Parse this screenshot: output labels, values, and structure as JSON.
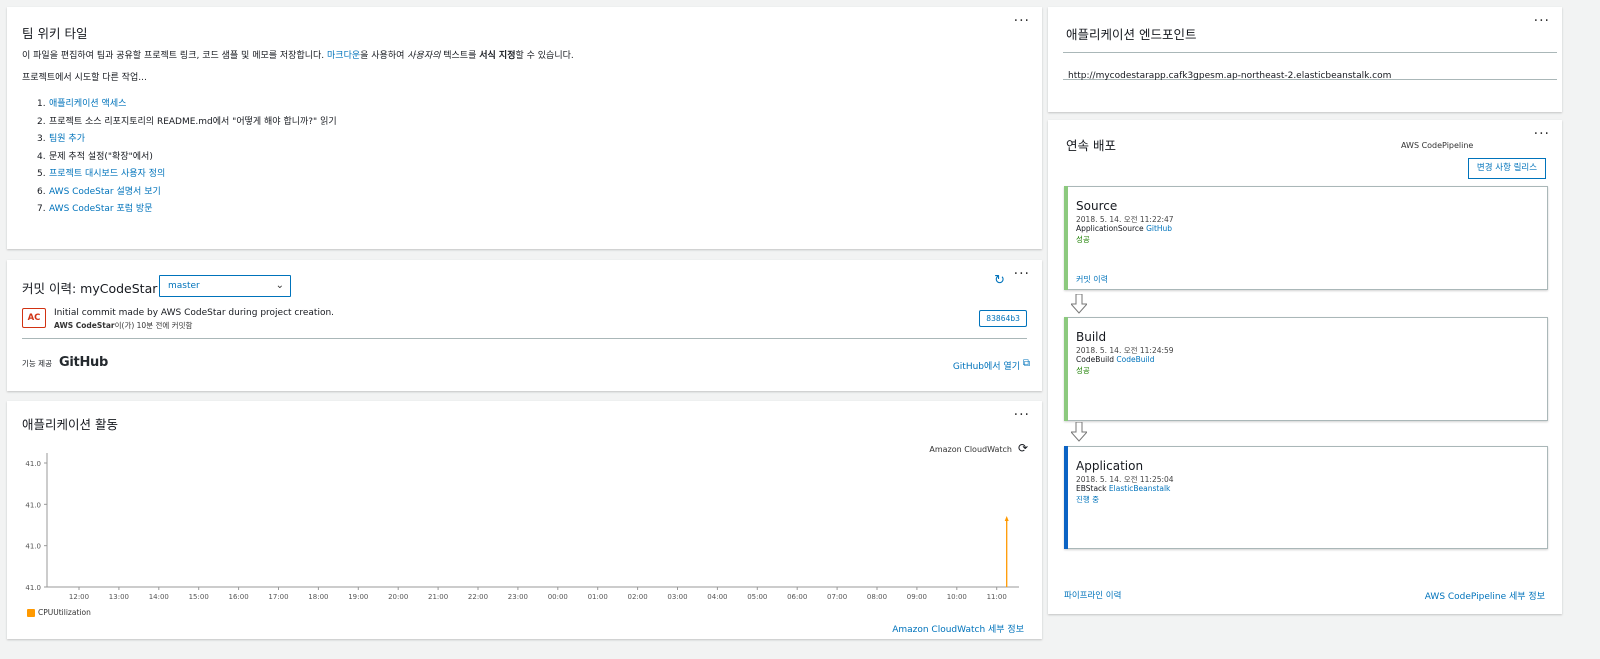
{
  "wiki": {
    "title": "팀 위키 타일",
    "desc_pre": "이 파일을 편집하여 팀과 공유할 프로젝트 링크, 코드 샘플 및 메모를 저장합니다. ",
    "desc_link": "마크다운",
    "desc_mid": "을 사용하여 ",
    "desc_italic": "사용자의",
    "desc_mid2": " 텍스트를 ",
    "desc_bold": "서식 지정",
    "desc_post": "할 수 있습니다.",
    "subtitle": "프로젝트에서 시도할 다른 작업...",
    "items": [
      {
        "num": "1.",
        "text": "애플리케이션 액세스",
        "link": true
      },
      {
        "num": "2.",
        "text": "프로젝트 소스 리포지토리의 README.md에서 \"어떻게 해야 합니까?\" 읽기",
        "link": false
      },
      {
        "num": "3.",
        "text": "팀원 추가",
        "link": true
      },
      {
        "num": "4.",
        "text": "문제 추적 설정(\"확장\"에서)",
        "link": false
      },
      {
        "num": "5.",
        "text": "프로젝트 대시보드 사용자 정의",
        "link": true
      },
      {
        "num": "6.",
        "text": "AWS CodeStar 설명서 보기",
        "link": true
      },
      {
        "num": "7.",
        "text": "AWS CodeStar 포럼 방문",
        "link": true
      }
    ]
  },
  "commits": {
    "title": "커밋 이력: myCodeStar",
    "branch": "master",
    "avatar": "AC",
    "message": "Initial commit made by AWS CodeStar during project creation.",
    "author": "AWS CodeStar",
    "meta": "이(가) 10분 전에 커밋함",
    "hash": "83864b3",
    "powered_by": "기능 제공",
    "provider": "GitHub",
    "open_link": "GitHub에서 열기"
  },
  "activity": {
    "title": "애플리케이션 활동",
    "source": "Amazon CloudWatch",
    "detail_link": "Amazon CloudWatch 세부 정보"
  },
  "chart_data": {
    "type": "line",
    "title": "",
    "xlabel": "",
    "ylabel": "",
    "y_ticks": [
      "41.0",
      "41.0",
      "41.0",
      "41.0"
    ],
    "x": [
      "12:00",
      "13:00",
      "14:00",
      "15:00",
      "16:00",
      "17:00",
      "18:00",
      "19:00",
      "20:00",
      "21:00",
      "22:00",
      "23:00",
      "00:00",
      "01:00",
      "02:00",
      "03:00",
      "04:00",
      "05:00",
      "06:00",
      "07:00",
      "08:00",
      "09:00",
      "10:00",
      "11:00"
    ],
    "series": [
      {
        "name": "CPUUtilization",
        "color": "#ff9900",
        "points": [
          {
            "x": "11:00",
            "y": 41.0
          }
        ]
      }
    ],
    "grid": false,
    "legend": "bottom-left"
  },
  "endpoint": {
    "title": "애플리케이션 엔드포인트",
    "url": "http://mycodestarapp.cafk3gpesm.ap-northeast-2.elasticbeanstalk.com"
  },
  "pipeline": {
    "title": "연속 배포",
    "provider": "AWS CodePipeline",
    "release_button": "변경 사항 릴리스",
    "stages": [
      {
        "name": "Source",
        "time": "2018. 5. 14. 오전 11:22:47",
        "action": "ApplicationSource",
        "action_link": "GitHub",
        "status": "성공",
        "status_color": "#1d8102",
        "bar_color": "#8cc97e",
        "history": "커밋 이력"
      },
      {
        "name": "Build",
        "time": "2018. 5. 14. 오전 11:24:59",
        "action": "CodeBuild",
        "action_link": "CodeBuild",
        "status": "성공",
        "status_color": "#1d8102",
        "bar_color": "#8cc97e",
        "history": ""
      },
      {
        "name": "Application",
        "time": "2018. 5. 14. 오전 11:25:04",
        "action": "EBStack",
        "action_link": "ElasticBeanstalk",
        "status": "진행 중",
        "status_color": "#0073bb",
        "bar_color": "#0b63c4",
        "history": ""
      }
    ],
    "history_link": "파이프라인 이력",
    "detail_link": "AWS CodePipeline 세부 정보"
  }
}
